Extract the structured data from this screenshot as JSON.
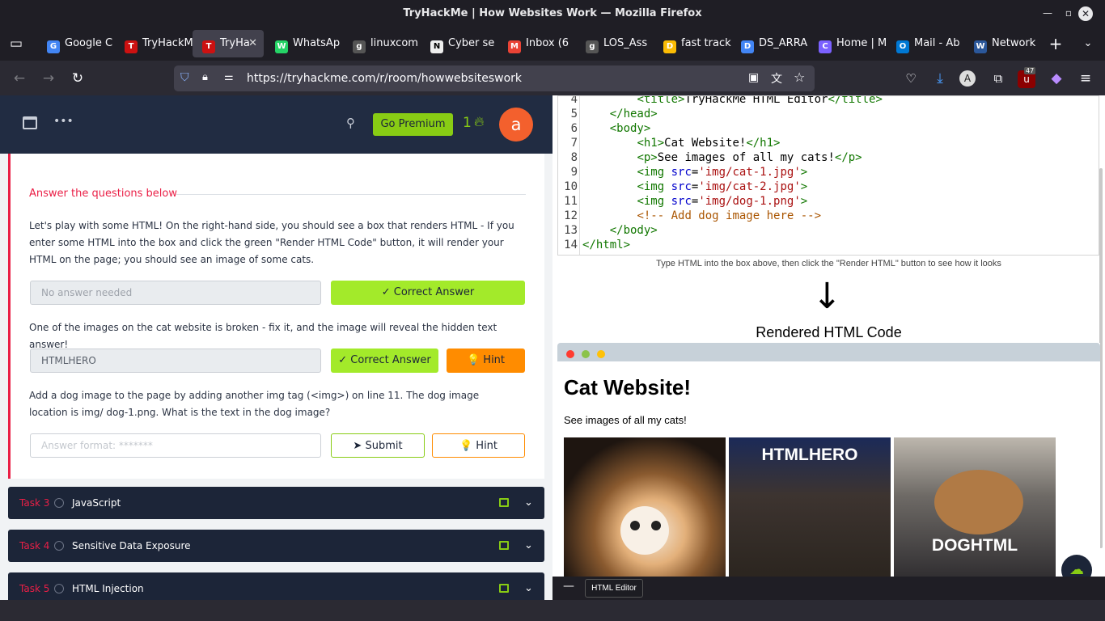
{
  "window": {
    "title": "TryHackMe | How Websites Work — Mozilla Firefox"
  },
  "tabs": [
    {
      "label": "Google C",
      "favicon": "G"
    },
    {
      "label": "TryHackM",
      "favicon": "T"
    },
    {
      "label": "TryHa",
      "favicon": "T",
      "active": true
    },
    {
      "label": "WhatsAp",
      "favicon": "W"
    },
    {
      "label": "linuxcom",
      "favicon": "g"
    },
    {
      "label": "Cyber se",
      "favicon": "N"
    },
    {
      "label": "Inbox (6",
      "favicon": "M"
    },
    {
      "label": "LOS_Ass",
      "favicon": "g"
    },
    {
      "label": "fast track",
      "favicon": "D"
    },
    {
      "label": "DS_ARRA",
      "favicon": "D"
    },
    {
      "label": "Home | M",
      "favicon": "C"
    },
    {
      "label": "Mail - Ab",
      "favicon": "O"
    },
    {
      "label": "Network",
      "favicon": "W"
    }
  ],
  "url": "https://tryhackme.com/r/room/howwebsiteswork",
  "toolbar": {
    "badge_count": "47"
  },
  "thm_header": {
    "premium_label": "Go Premium",
    "streak": "1",
    "avatar_letter": "a"
  },
  "questions": {
    "heading": "Answer the questions below",
    "q1": {
      "text": "Let's play with some HTML! On the right-hand side, you should see a box that renders HTML - If you enter some HTML into the box and click the green \"Render HTML Code\" button, it will render your HTML on the page; you should see an image of some cats.",
      "placeholder": "No answer needed",
      "button": "✓ Correct Answer"
    },
    "q2": {
      "text": "One of the images on the cat website is broken - fix it, and the image will reveal the hidden text answer!",
      "value": "HTMLHERO",
      "button": "✓ Correct Answer",
      "hint": "💡 Hint"
    },
    "q3": {
      "text": "Add a dog image to the page by adding another img tag (<img>) on line 11. The dog image location is img/ dog-1.png. What is the text in the dog image?",
      "placeholder": "Answer format: *******",
      "submit": "➤ Submit",
      "hint": "💡 Hint"
    }
  },
  "tasks": [
    {
      "num": "Task 3",
      "name": "JavaScript"
    },
    {
      "num": "Task 4",
      "name": "Sensitive Data Exposure"
    },
    {
      "num": "Task 5",
      "name": "HTML Injection"
    }
  ],
  "editor": {
    "line_numbers": [
      "4",
      "5",
      "6",
      "7",
      "8",
      "9",
      "10",
      "11",
      "12",
      "13",
      "14"
    ]
  },
  "render_hint": "Type HTML into the box above, then click the \"Render HTML\" button to see how it looks",
  "rendered_title": "Rendered HTML Code",
  "rendered_page": {
    "h1": "Cat Website!",
    "p": "See images of all my cats!",
    "image_texts": [
      "HTMLHERO",
      "DOGHTML"
    ]
  },
  "bottom": {
    "html_editor_label": "HTML Editor"
  }
}
